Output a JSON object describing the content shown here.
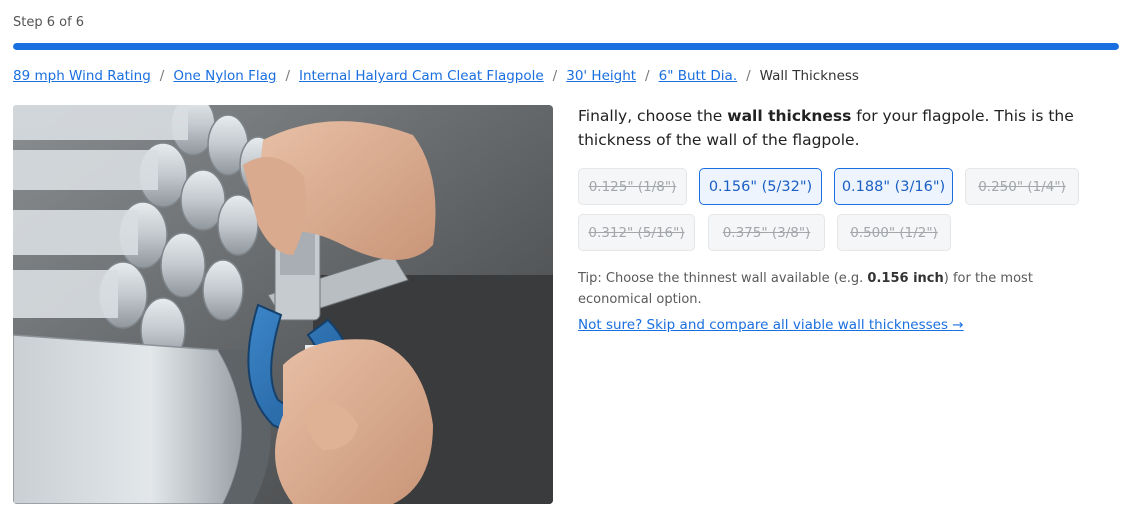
{
  "step": {
    "label": "Step 6 of 6",
    "progress": 1.0
  },
  "breadcrumb": {
    "items": [
      "89 mph Wind Rating",
      "One Nylon Flag",
      "Internal Halyard Cam Cleat Flagpole",
      "30' Height",
      "6\" Butt Dia."
    ],
    "separator": "/",
    "current": "Wall Thickness"
  },
  "question": {
    "prefix": "Finally, choose the ",
    "emphasis": "wall thickness",
    "suffix": " for your flagpole. This is the thickness of the wall of the flagpole."
  },
  "options": [
    {
      "label": "0.125\" (1/8\")",
      "available": false
    },
    {
      "label": "0.156\" (5/32\")",
      "available": true
    },
    {
      "label": "0.188\" (3/16\")",
      "available": true
    },
    {
      "label": "0.250\" (1/4\")",
      "available": false
    },
    {
      "label": "0.312\" (5/16\")",
      "available": false
    },
    {
      "label": "0.375\" (3/8\")",
      "available": false
    },
    {
      "label": "0.500\" (1/2\")",
      "available": false
    }
  ],
  "tip": {
    "prefix": "Tip: Choose the thinnest wall available (e.g. ",
    "emphasis": "0.156 inch",
    "suffix": ") for the most economical option."
  },
  "skip_link": {
    "label": "Not sure? Skip and compare all viable wall thicknesses",
    "icon": "arrow-right-icon",
    "glyph": "→"
  },
  "colors": {
    "accent": "#1a6fe0",
    "progress_track": "#e3ecfb"
  }
}
